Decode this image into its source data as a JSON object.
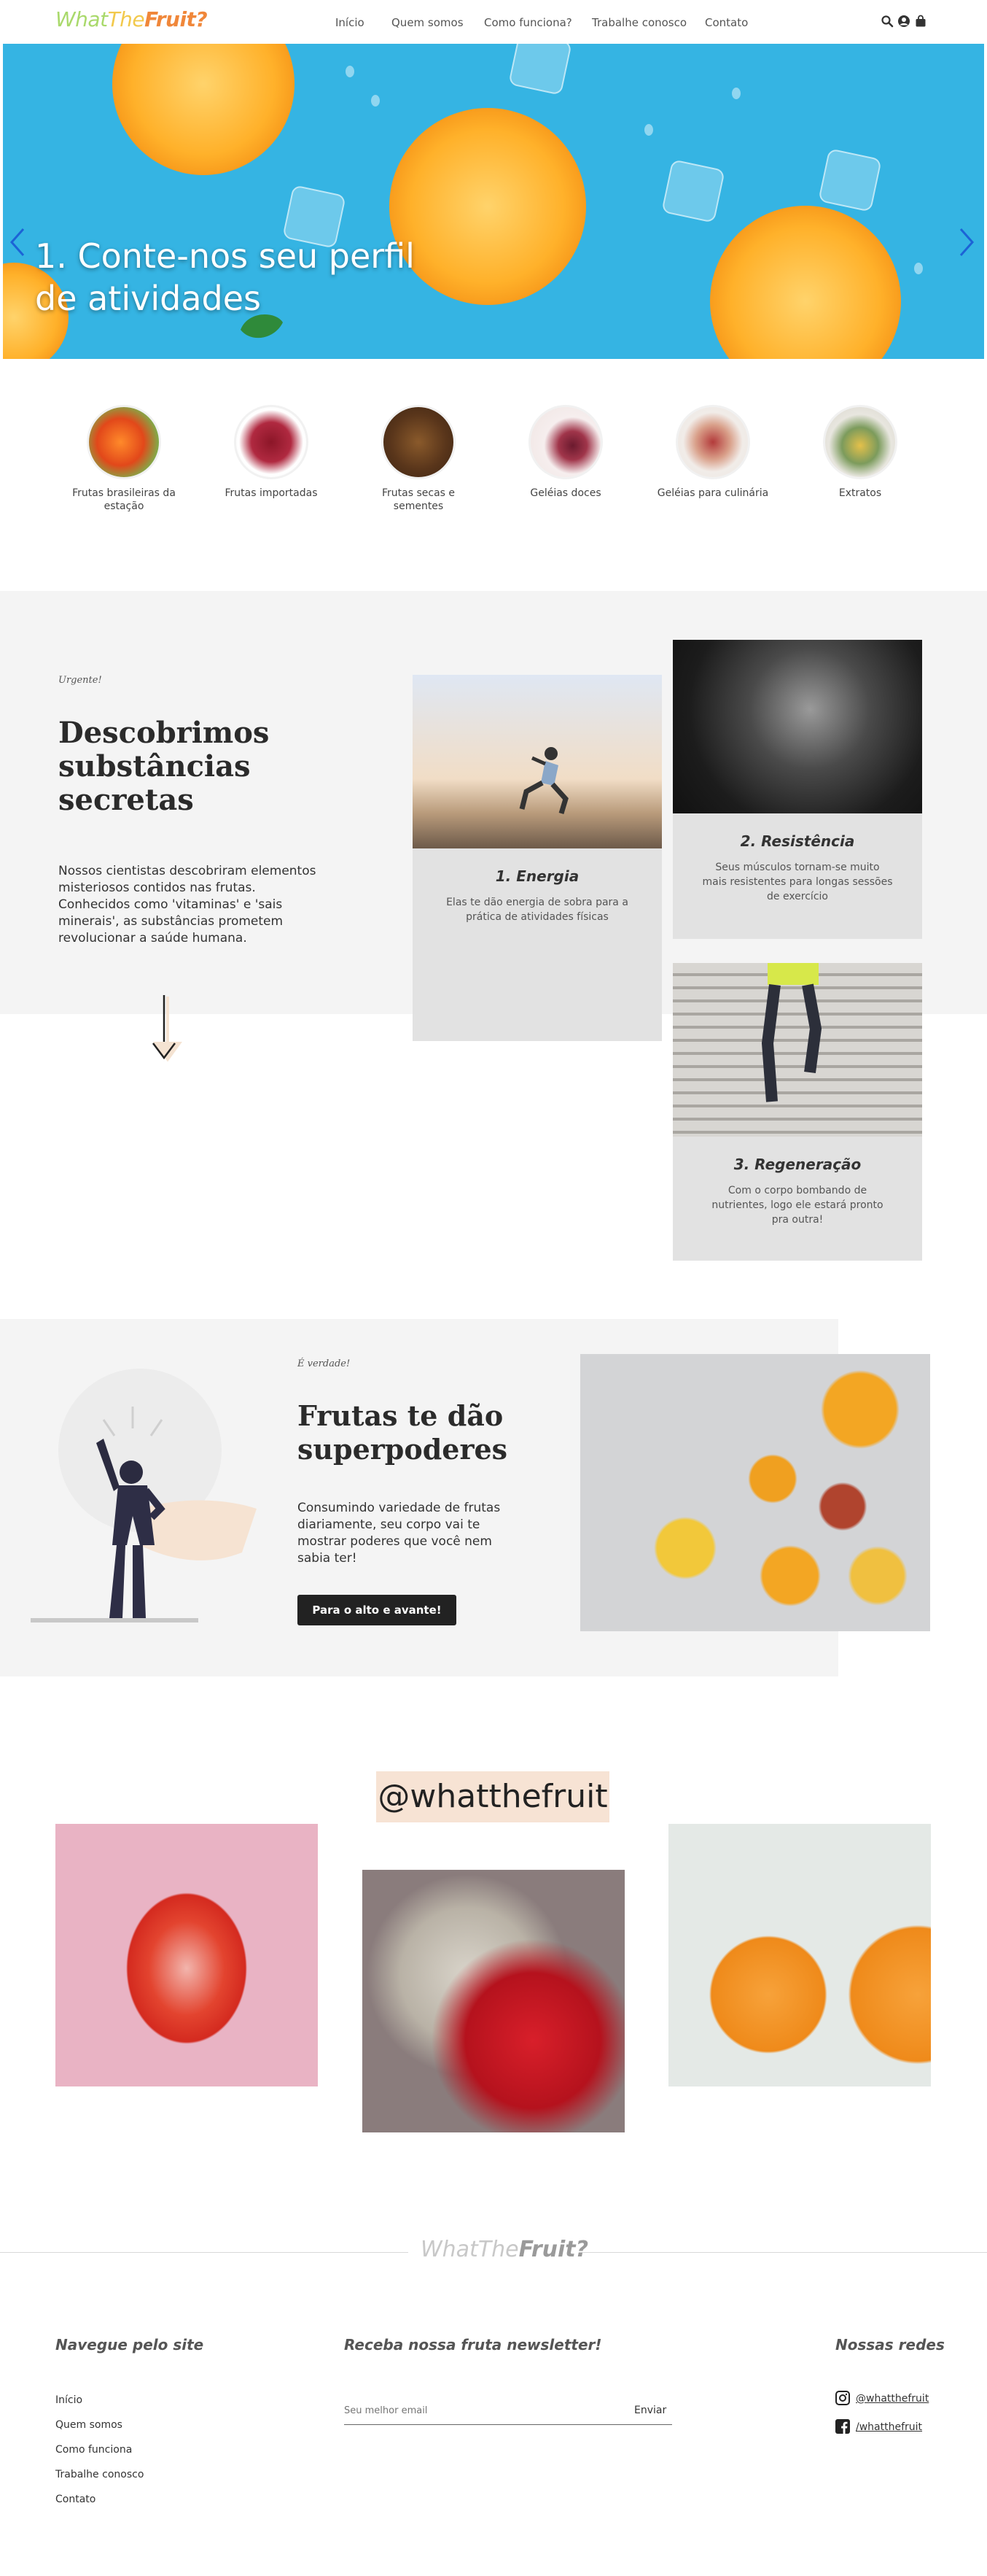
{
  "header": {
    "logo": {
      "what": "What",
      "the": "The",
      "fruit": "Fruit?"
    },
    "nav": [
      "Início",
      "Quem somos",
      "Como funciona?",
      "Trabalhe conosco",
      "Contato"
    ]
  },
  "hero": {
    "title_line1": "1. Conte-nos seu perfil",
    "title_line2": "de atividades",
    "slides_total": 4,
    "active_slide": 2
  },
  "categories": [
    {
      "label": "Frutas brasileiras da estação"
    },
    {
      "label": "Frutas importadas"
    },
    {
      "label": "Frutas secas e sementes"
    },
    {
      "label": "Geléias doces"
    },
    {
      "label": "Geléias para culinária"
    },
    {
      "label": "Extratos"
    }
  ],
  "discover": {
    "eyebrow": "Urgente!",
    "title": "Descobrimos substâncias secretas",
    "text": "Nossos cientistas descobriram elementos misteriosos contidos nas frutas. Conhecidos como 'vitaminas' e 'sais minerais', as substâncias prometem revolucionar a saúde humana.",
    "cards": [
      {
        "title": "1. Energia",
        "text": "Elas te dão energia de sobra para a prática de atividades físicas"
      },
      {
        "title": "2. Resistência",
        "text": "Seus músculos tornam-se muito mais resistentes para longas sessões de exercício"
      },
      {
        "title": "3. Regeneração",
        "text": "Com o corpo bombando de nutrientes, logo ele estará pronto pra outra!"
      }
    ]
  },
  "powers": {
    "eyebrow": "É verdade!",
    "title": "Frutas te dão superpoderes",
    "text": "Consumindo variedade de frutas diariamente, seu corpo vai te mostrar poderes que você nem sabia ter!",
    "button": "Para o alto e avante!"
  },
  "instagram": {
    "handle": "@whatthefruit"
  },
  "footer": {
    "logo": {
      "what": "What",
      "the": "The",
      "fruit": "Fruit?"
    },
    "nav_title": "Navegue pelo site",
    "nav_links": [
      "Início",
      "Quem somos",
      "Como funciona",
      "Trabalhe conosco",
      "Contato"
    ],
    "newsletter_title": "Receba nossa fruta newsletter!",
    "newsletter_placeholder": "Seu melhor email",
    "newsletter_button": "Enviar",
    "social_title": "Nossas redes",
    "social": [
      {
        "icon": "instagram-icon",
        "label": "@whatthefruit"
      },
      {
        "icon": "facebook-icon",
        "label": "/whatthefruit"
      }
    ]
  }
}
